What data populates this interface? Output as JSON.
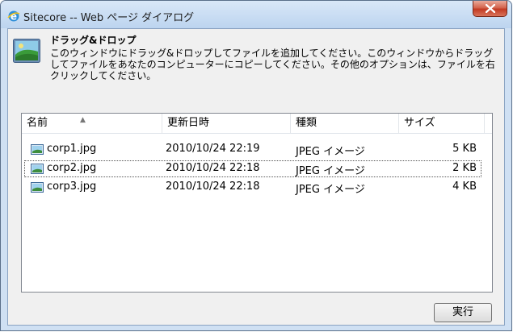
{
  "window": {
    "title": "Sitecore -- Web ページ ダイアログ"
  },
  "header": {
    "title": "ドラッグ&ドロップ",
    "description": "このウィンドウにドラッグ&ドロップしてファイルを追加してください。このウィンドウからドラッグしてファイルをあなたのコンピューターにコピーしてください。その他のオプションは、ファイルを右クリックしてください。"
  },
  "list": {
    "columns": [
      "名前",
      "更新日時",
      "種類",
      "サイズ"
    ],
    "rows": [
      {
        "name": "corp1.jpg",
        "modified": "2010/10/24 22:19",
        "type": "JPEG イメージ",
        "size": "5 KB"
      },
      {
        "name": "corp2.jpg",
        "modified": "2010/10/24 22:18",
        "type": "JPEG イメージ",
        "size": "2 KB",
        "selected": true
      },
      {
        "name": "corp3.jpg",
        "modified": "2010/10/24 22:18",
        "type": "JPEG イメージ",
        "size": "4 KB"
      }
    ]
  },
  "buttons": {
    "execute": "実行"
  },
  "icons": {
    "window": "ie-icon",
    "close": "close-icon",
    "header": "image-icon",
    "file": "jpeg-file-icon"
  }
}
